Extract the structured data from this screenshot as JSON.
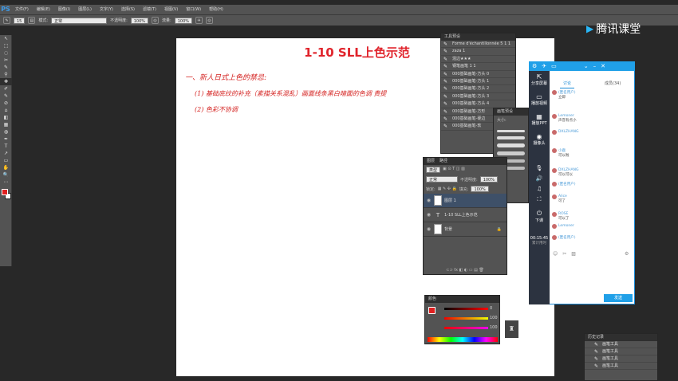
{
  "app": {
    "logo": "PS"
  },
  "menu": [
    "文件(F)",
    "编辑(E)",
    "图像(I)",
    "图层(L)",
    "文字(Y)",
    "选择(S)",
    "滤镜(T)",
    "视图(V)",
    "窗口(W)",
    "帮助(H)"
  ],
  "options": {
    "size": "15",
    "mode_label": "模式:",
    "mode_value": "正常",
    "opacity_label": "不透明度:",
    "opacity_value": "100%",
    "flow_label": "流量:",
    "flow_value": "100%"
  },
  "canvas": {
    "title": "1-10 SLL上色示范",
    "notes": [
      "一、新人日式上色的禁忌:",
      "(1) 基础底纹的补充（素描关系混乱）画面线条黑白暗面的色调  责提",
      "(2) 色彩不协调"
    ]
  },
  "brush_presets": {
    "title": "工具预设",
    "items": [
      "Forme d'échantillonnée 5 1 1",
      "zaza 1",
      "混边★★★",
      "钢笔画笔 1 1",
      "000基础画笔-方头 0",
      "000基础画笔-方头 1",
      "000基础画笔-方头 2",
      "000基础画笔-方头 3",
      "000基础画笔-方头 4",
      "000基础画笔-方形",
      "000基础画笔-硬边",
      "000基础画笔-软"
    ]
  },
  "brush_size": {
    "title": "画笔预设",
    "label": "大小:"
  },
  "layers": {
    "tabs": [
      "图层",
      "路径"
    ],
    "kind": "类型",
    "blend": "正常",
    "opacity_label": "不透明度:",
    "opacity": "100%",
    "lock_label": "锁定:",
    "fill_label": "填充:",
    "fill": "100%",
    "rows": [
      {
        "name": "图层 1",
        "type": "image"
      },
      {
        "name": "1-10 SLL上色示范",
        "type": "text"
      },
      {
        "name": "背景",
        "type": "bg"
      }
    ]
  },
  "color": {
    "title": "颜色",
    "r": "0",
    "g": "100",
    "b": "100"
  },
  "history": {
    "title": "历史记录",
    "items": [
      "画笔工具",
      "画笔工具",
      "画笔工具",
      "画笔工具"
    ]
  },
  "tencent": {
    "name": "腾讯课堂"
  },
  "qq": {
    "tabs": [
      "讨论",
      "成员(34)"
    ],
    "side": [
      {
        "g": "⇱",
        "label": "分享屏幕"
      },
      {
        "g": "▭",
        "label": "播放视频"
      },
      {
        "g": "▦",
        "label": "播放PPT"
      },
      {
        "g": "◉",
        "label": "摄像头"
      }
    ],
    "time": "00:15:45",
    "status": "累计用时",
    "end": "下课",
    "send": "发送",
    "chats": [
      {
        "name": "(匿名用户)",
        "msg": "立即"
      },
      {
        "name": "Lemoner",
        "msg": "声音有点小"
      },
      {
        "name": "DXLZHANG",
        "msg": ""
      },
      {
        "name": "小鹿",
        "msg": "可以啦"
      },
      {
        "name": "DXLZHANG",
        "msg": "可以可以"
      },
      {
        "name": "(匿名用户)",
        "msg": ""
      },
      {
        "name": "Alice",
        "msg": "可了"
      },
      {
        "name": "ROSE",
        "msg": "可以了"
      },
      {
        "name": "Lemoner",
        "msg": ""
      },
      {
        "name": "(匿名用户)",
        "msg": ""
      }
    ]
  }
}
